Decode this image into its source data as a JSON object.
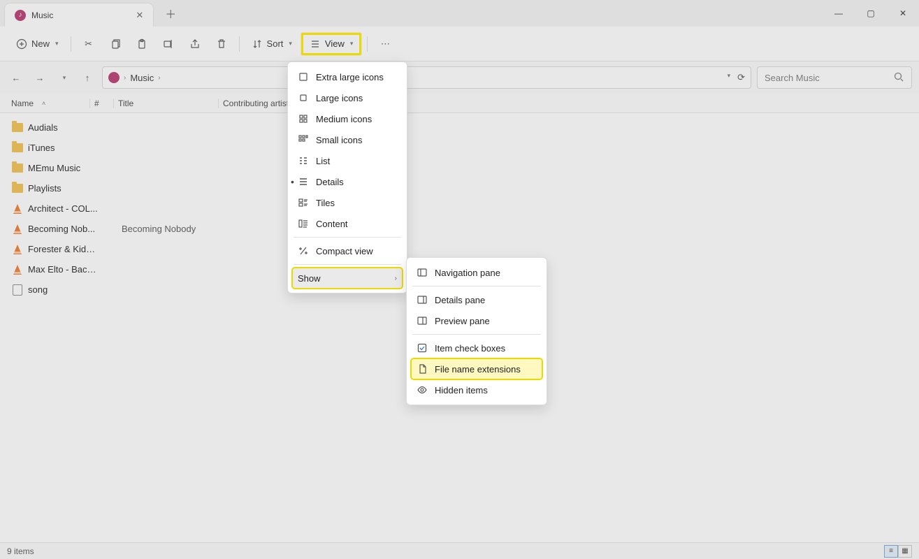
{
  "titlebar": {
    "tab_title": "Music"
  },
  "toolbar": {
    "new_label": "New",
    "sort_label": "Sort",
    "view_label": "View"
  },
  "breadcrumb": {
    "segments": [
      "Music"
    ]
  },
  "search": {
    "placeholder": "Search Music"
  },
  "columns": {
    "name": "Name",
    "number": "#",
    "title": "Title",
    "artist": "Contributing artists"
  },
  "files": [
    {
      "type": "folder",
      "name": "Audials"
    },
    {
      "type": "folder",
      "name": "iTunes"
    },
    {
      "type": "folder",
      "name": "MEmu Music"
    },
    {
      "type": "folder",
      "name": "Playlists"
    },
    {
      "type": "media",
      "name": "Architect - COL..."
    },
    {
      "type": "media",
      "name": "Becoming Nob...",
      "title": "Becoming Nobody"
    },
    {
      "type": "media",
      "name": "Forester & Kidn..."
    },
    {
      "type": "media",
      "name": "Max Elto - Back..."
    },
    {
      "type": "file",
      "name": "song"
    }
  ],
  "view_menu": {
    "items": [
      {
        "label": "Extra large icons"
      },
      {
        "label": "Large icons"
      },
      {
        "label": "Medium icons"
      },
      {
        "label": "Small icons"
      },
      {
        "label": "List"
      },
      {
        "label": "Details",
        "selected": true
      },
      {
        "label": "Tiles"
      },
      {
        "label": "Content"
      }
    ],
    "compact": "Compact view",
    "show": "Show"
  },
  "show_submenu": {
    "nav": "Navigation pane",
    "details": "Details pane",
    "preview": "Preview pane",
    "checkboxes": "Item check boxes",
    "extensions": "File name extensions",
    "hidden": "Hidden items"
  },
  "status": {
    "count": "9 items"
  }
}
